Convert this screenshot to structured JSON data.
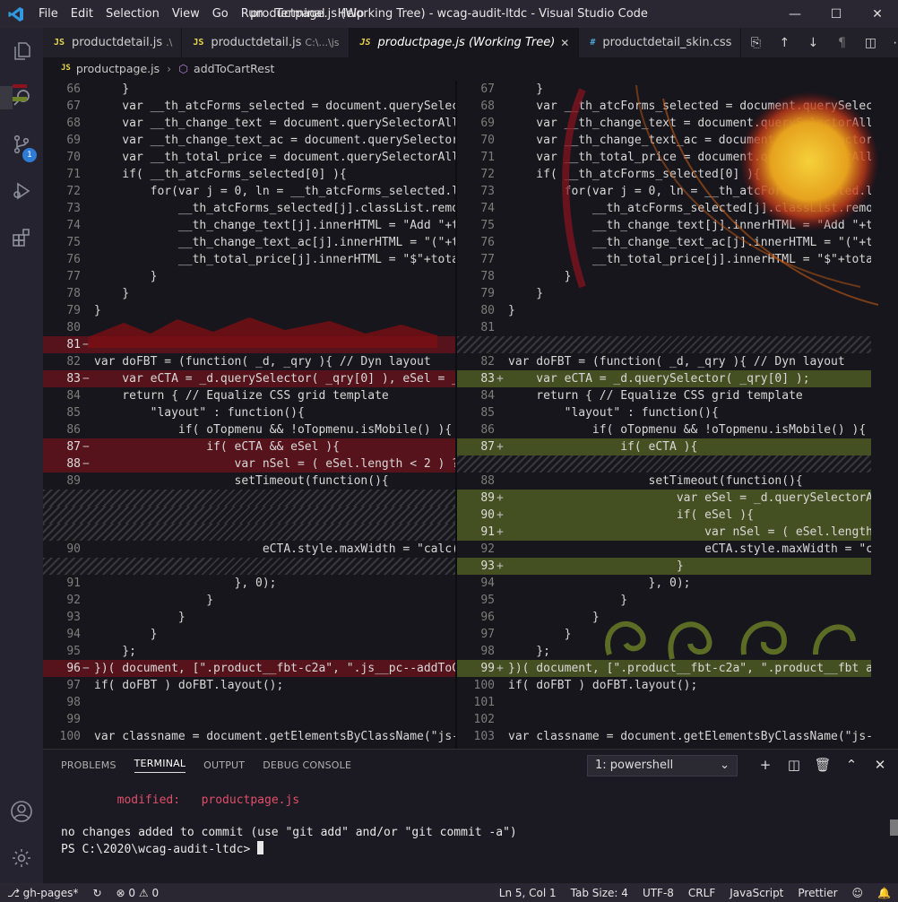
{
  "window": {
    "title": "productpage.js (Working Tree) - wcag-audit-ltdc - Visual Studio Code",
    "menu": [
      "File",
      "Edit",
      "Selection",
      "View",
      "Go",
      "Run",
      "Terminal",
      "Help"
    ]
  },
  "activity": {
    "source_control_badge": "1"
  },
  "tabs": [
    {
      "lang": "JS",
      "name": "productdetail.js",
      "desc": ".\\",
      "active": false
    },
    {
      "lang": "JS",
      "name": "productdetail.js",
      "desc": "C:\\...\\js",
      "active": false
    },
    {
      "lang": "JS",
      "name": "productpage.js (Working Tree)",
      "desc": "",
      "active": true
    },
    {
      "lang": "#",
      "name": "productdetail_skin.css",
      "desc": "",
      "active": false
    }
  ],
  "breadcrumb": {
    "file_lang": "JS",
    "file": "productpage.js",
    "symbol": "addToCartRest"
  },
  "left_lines": [
    {
      "n": "66",
      "m": "",
      "t": "",
      "c": "    }"
    },
    {
      "n": "67",
      "m": "",
      "t": "",
      "c": "    var __th_atcForms_selected = document.querySelect"
    },
    {
      "n": "68",
      "m": "",
      "t": "",
      "c": "    var __th_change_text = document.querySelectorAll("
    },
    {
      "n": "69",
      "m": "",
      "t": "",
      "c": "    var __th_change_text_ac = document.querySelectorA"
    },
    {
      "n": "70",
      "m": "",
      "t": "",
      "c": "    var __th_total_price = document.querySelectorAll("
    },
    {
      "n": "71",
      "m": "",
      "t": "",
      "c": "    if( __th_atcForms_selected[0] ){"
    },
    {
      "n": "72",
      "m": "",
      "t": "",
      "c": "        for(var j = 0, ln = __th_atcForms_selected.le"
    },
    {
      "n": "73",
      "m": "",
      "t": "",
      "c": "            __th_atcForms_selected[j].classList.remov"
    },
    {
      "n": "74",
      "m": "",
      "t": "",
      "c": "            __th_change_text[j].innerHTML = \"Add \"+to"
    },
    {
      "n": "75",
      "m": "",
      "t": "",
      "c": "            __th_change_text_ac[j].innerHTML = \"(\"+to"
    },
    {
      "n": "76",
      "m": "",
      "t": "",
      "c": "            __th_total_price[j].innerHTML = \"$\"+total"
    },
    {
      "n": "77",
      "m": "",
      "t": "",
      "c": "        }"
    },
    {
      "n": "78",
      "m": "",
      "t": "",
      "c": "    }"
    },
    {
      "n": "79",
      "m": "",
      "t": "",
      "c": "}"
    },
    {
      "n": "80",
      "m": "",
      "t": "",
      "c": ""
    },
    {
      "n": "81",
      "m": "−",
      "t": "del",
      "c": ""
    },
    {
      "n": "82",
      "m": "",
      "t": "",
      "c": "var doFBT = (function( _d, _qry ){ // Dyn layout"
    },
    {
      "n": "83",
      "m": "−",
      "t": "del",
      "c": "    var eCTA = _d.querySelector( _qry[0] ), eSel = _d"
    },
    {
      "n": "84",
      "m": "",
      "t": "",
      "c": "    return { // Equalize CSS grid template"
    },
    {
      "n": "85",
      "m": "",
      "t": "",
      "c": "        \"layout\" : function(){"
    },
    {
      "n": "86",
      "m": "",
      "t": "",
      "c": "            if( oTopmenu && !oTopmenu.isMobile() ){"
    },
    {
      "n": "87",
      "m": "−",
      "t": "del",
      "c": "                if( eCTA && eSel ){"
    },
    {
      "n": "88",
      "m": "−",
      "t": "del",
      "c": "                    var nSel = ( eSel.length < 2 ) ?"
    },
    {
      "n": "89",
      "m": "",
      "t": "",
      "c": "                    setTimeout(function(){"
    },
    {
      "n": "",
      "m": "",
      "t": "hatch",
      "c": ""
    },
    {
      "n": "",
      "m": "",
      "t": "hatch",
      "c": ""
    },
    {
      "n": "",
      "m": "",
      "t": "hatch",
      "c": ""
    },
    {
      "n": "90",
      "m": "",
      "t": "",
      "c": "                        eCTA.style.maxWidth = \"calc(1"
    },
    {
      "n": "",
      "m": "",
      "t": "hatch",
      "c": ""
    },
    {
      "n": "91",
      "m": "",
      "t": "",
      "c": "                    }, 0);"
    },
    {
      "n": "92",
      "m": "",
      "t": "",
      "c": "                }"
    },
    {
      "n": "93",
      "m": "",
      "t": "",
      "c": "            }"
    },
    {
      "n": "94",
      "m": "",
      "t": "",
      "c": "        }"
    },
    {
      "n": "95",
      "m": "",
      "t": "",
      "c": "    };"
    },
    {
      "n": "96",
      "m": "−",
      "t": "del",
      "c": "})( document, [\".product__fbt-c2a\", \".js__pc--addToCa"
    },
    {
      "n": "97",
      "m": "",
      "t": "",
      "c": "if( doFBT ) doFBT.layout();"
    },
    {
      "n": "98",
      "m": "",
      "t": "",
      "c": ""
    },
    {
      "n": "99",
      "m": "",
      "t": "",
      "c": ""
    },
    {
      "n": "100",
      "m": "",
      "t": "",
      "c": "var classname = document.getElementsByClassName(\"js-p"
    }
  ],
  "right_lines": [
    {
      "n": "67",
      "m": "",
      "t": "",
      "c": "    }"
    },
    {
      "n": "68",
      "m": "",
      "t": "",
      "c": "    var __th_atcForms_selected = document.querySelect"
    },
    {
      "n": "69",
      "m": "",
      "t": "",
      "c": "    var __th_change_text = document.querySelectorAll("
    },
    {
      "n": "70",
      "m": "",
      "t": "",
      "c": "    var __th_change_text_ac = document.querySelectorA"
    },
    {
      "n": "71",
      "m": "",
      "t": "",
      "c": "    var __th_total_price = document.querySelectorAll("
    },
    {
      "n": "72",
      "m": "",
      "t": "",
      "c": "    if( __th_atcForms_selected[0] ){"
    },
    {
      "n": "73",
      "m": "",
      "t": "",
      "c": "        for(var j = 0, ln = __th_atcForms_selected.le"
    },
    {
      "n": "74",
      "m": "",
      "t": "",
      "c": "            __th_atcForms_selected[j].classList.remov"
    },
    {
      "n": "75",
      "m": "",
      "t": "",
      "c": "            __th_change_text[j].innerHTML = \"Add \"+to"
    },
    {
      "n": "76",
      "m": "",
      "t": "",
      "c": "            __th_change_text_ac[j].innerHTML = \"(\"+to"
    },
    {
      "n": "77",
      "m": "",
      "t": "",
      "c": "            __th_total_price[j].innerHTML = \"$\"+total"
    },
    {
      "n": "78",
      "m": "",
      "t": "",
      "c": "        }"
    },
    {
      "n": "79",
      "m": "",
      "t": "",
      "c": "    }"
    },
    {
      "n": "80",
      "m": "",
      "t": "",
      "c": "}"
    },
    {
      "n": "81",
      "m": "",
      "t": "",
      "c": ""
    },
    {
      "n": "",
      "m": "",
      "t": "hatch",
      "c": ""
    },
    {
      "n": "82",
      "m": "",
      "t": "",
      "c": "var doFBT = (function( _d, _qry ){ // Dyn layout"
    },
    {
      "n": "83",
      "m": "+",
      "t": "ins",
      "c": "    var eCTA = _d.querySelector( _qry[0] );"
    },
    {
      "n": "84",
      "m": "",
      "t": "",
      "c": "    return { // Equalize CSS grid template"
    },
    {
      "n": "85",
      "m": "",
      "t": "",
      "c": "        \"layout\" : function(){"
    },
    {
      "n": "86",
      "m": "",
      "t": "",
      "c": "            if( oTopmenu && !oTopmenu.isMobile() ){"
    },
    {
      "n": "87",
      "m": "+",
      "t": "ins",
      "c": "                if( eCTA ){"
    },
    {
      "n": "",
      "m": "",
      "t": "hatch",
      "c": ""
    },
    {
      "n": "88",
      "m": "",
      "t": "",
      "c": "                    setTimeout(function(){"
    },
    {
      "n": "89",
      "m": "+",
      "t": "ins",
      "c": "                        var eSel = _d.querySelectorAl"
    },
    {
      "n": "90",
      "m": "+",
      "t": "ins",
      "c": "                        if( eSel ){"
    },
    {
      "n": "91",
      "m": "+",
      "t": "ins",
      "c": "                            var nSel = ( eSel.length"
    },
    {
      "n": "92",
      "m": "",
      "t": "",
      "c": "                            eCTA.style.maxWidth = \"ca"
    },
    {
      "n": "93",
      "m": "+",
      "t": "ins",
      "c": "                        }"
    },
    {
      "n": "94",
      "m": "",
      "t": "",
      "c": "                    }, 0);"
    },
    {
      "n": "95",
      "m": "",
      "t": "",
      "c": "                }"
    },
    {
      "n": "96",
      "m": "",
      "t": "",
      "c": "            }"
    },
    {
      "n": "97",
      "m": "",
      "t": "",
      "c": "        }"
    },
    {
      "n": "98",
      "m": "",
      "t": "",
      "c": "    };"
    },
    {
      "n": "99",
      "m": "+",
      "t": "ins",
      "c": "})( document, [\".product__fbt-c2a\", \".product__fbt ar"
    },
    {
      "n": "100",
      "m": "",
      "t": "",
      "c": "if( doFBT ) doFBT.layout();"
    },
    {
      "n": "101",
      "m": "",
      "t": "",
      "c": ""
    },
    {
      "n": "102",
      "m": "",
      "t": "",
      "c": ""
    },
    {
      "n": "103",
      "m": "",
      "t": "",
      "c": "var classname = document.getElementsByClassName(\"js-p"
    }
  ],
  "panel": {
    "tabs": [
      "PROBLEMS",
      "TERMINAL",
      "OUTPUT",
      "DEBUG CONSOLE"
    ],
    "active_tab": "TERMINAL",
    "terminal_select": "1: powershell",
    "term_modified_label": "modified:",
    "term_modified_file": "productpage.js",
    "term_line1": "no changes added to commit (use \"git add\" and/or \"git commit -a\")",
    "term_prompt": "PS C:\\2020\\wcag-audit-ltdc> "
  },
  "status": {
    "branch": "gh-pages*",
    "errors": "0",
    "warnings": "0",
    "position": "Ln 5, Col 1",
    "tab_size": "Tab Size: 4",
    "encoding": "UTF-8",
    "eol": "CRLF",
    "language": "JavaScript",
    "formatter": "Prettier"
  },
  "colors": {
    "deleted": "#8c121e",
    "inserted": "#6e8228",
    "accent": "#2f7cd6"
  }
}
